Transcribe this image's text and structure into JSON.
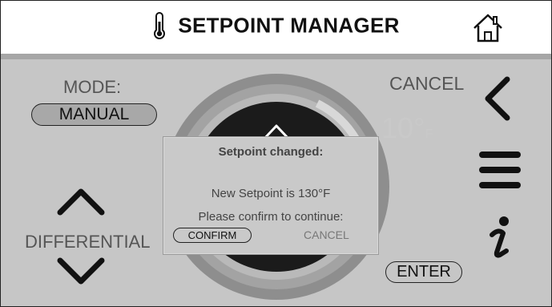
{
  "header": {
    "title": "SETPOINT MANAGER",
    "thermometer_icon": "thermometer-icon",
    "home_icon": "home-icon"
  },
  "mode": {
    "label": "MODE:",
    "value": "MANUAL"
  },
  "differential": {
    "label": "DIFFERENTIAL",
    "up_icon": "chevron-up-icon",
    "down_icon": "chevron-down-icon"
  },
  "right_panel": {
    "cancel_label": "CANCEL",
    "back_icon": "chevron-left-icon",
    "menu_icon": "menu-icon",
    "info_icon": "info-icon",
    "enter_label": "ENTER"
  },
  "dial": {
    "differential_value": "10°",
    "unit": "F"
  },
  "popup": {
    "title": "Setpoint changed:",
    "message_line1": "New Setpoint is 130°F",
    "message_line2": "Please confirm to continue:",
    "confirm_label": "CONFIRM",
    "cancel_label": "CANCEL"
  },
  "colors": {
    "background": "#c6c6c6",
    "header": "#ffffff",
    "dial_ring": "#8c8c8c",
    "dial_center": "#1a1a1a",
    "popup": "#c9c9c9"
  }
}
